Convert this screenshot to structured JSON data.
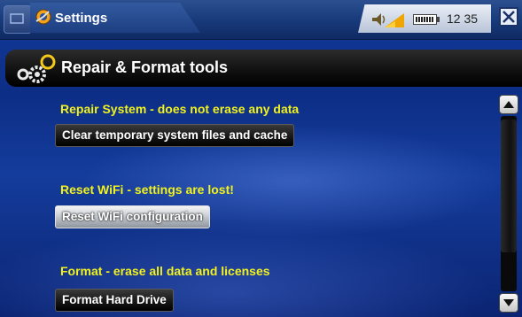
{
  "statusbar": {
    "app_title": "Settings",
    "time": "12 35"
  },
  "header": {
    "title": "Repair & Format tools"
  },
  "sections": [
    {
      "label": "Repair System - does not erase any data",
      "button": "Clear temporary system files and cache"
    },
    {
      "label": "Reset WiFi - settings are lost!",
      "button": "Reset WiFi configuration"
    },
    {
      "label": "Format - erase all data and licenses",
      "button": "Format Hard Drive"
    }
  ],
  "colors": {
    "section_label": "#f2f21c",
    "background": "#123a9a",
    "header_bar": "#111111"
  },
  "icons": {
    "home": "home-tab-icon",
    "settings": "gear-icon",
    "volume": "speaker-volume-icon",
    "battery": "battery-icon",
    "close": "close-x-icon",
    "header": "gears-icon",
    "scroll_up": "arrow-up-icon",
    "scroll_down": "arrow-down-icon"
  }
}
